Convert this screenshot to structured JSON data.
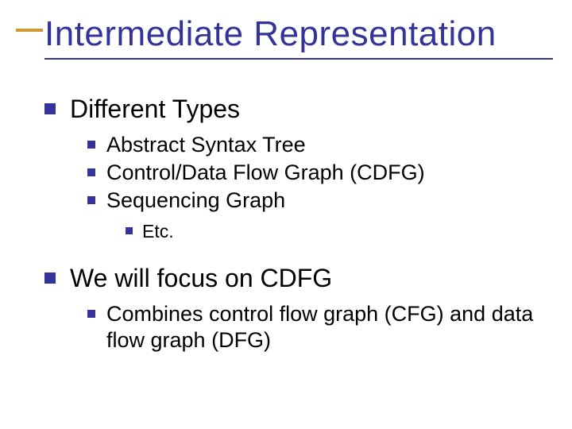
{
  "title": "Intermediate Representation",
  "items": [
    {
      "label": "Different Types",
      "children": [
        {
          "label": "Abstract Syntax Tree"
        },
        {
          "label": "Control/Data Flow Graph (CDFG)"
        },
        {
          "label": "Sequencing Graph",
          "children": [
            {
              "label": "Etc."
            }
          ]
        }
      ]
    },
    {
      "label": "We will focus on CDFG",
      "children": [
        {
          "label": "Combines control flow graph (CFG) and data flow graph (DFG)"
        }
      ]
    }
  ]
}
